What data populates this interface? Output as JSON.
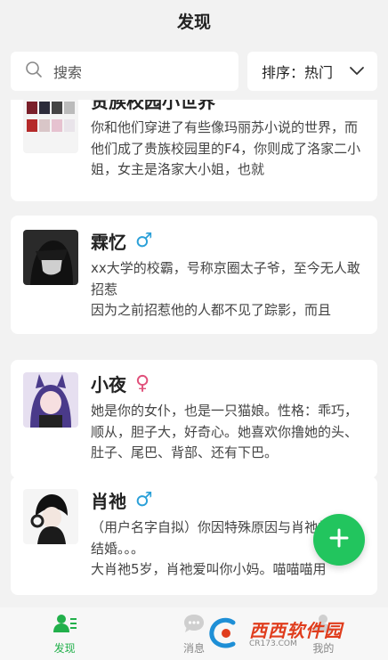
{
  "header": {
    "title": "发现"
  },
  "search": {
    "placeholder": "搜索"
  },
  "sort": {
    "label": "排序：热门"
  },
  "cards": [
    {
      "name": "贵族校园小世界",
      "gender": "",
      "description": "你和他们穿进了有些像玛丽苏小说的世界，而他们成了贵族校园里的F4，你则成了洛家二小姐，女主是洛家大小姐，也就"
    },
    {
      "name": "霖忆",
      "gender": "♂",
      "description": "xx大学的校霸，号称京圈太子爷，至今无人敢招惹\n因为之前招惹他的人都不见了踪影，而且"
    },
    {
      "name": "小夜",
      "gender": "♀",
      "description": "她是你的女仆，也是一只猫娘。性格：乖巧，顺从，胆子大，好奇心。她喜欢你撸她的头、肚子、尾巴、背部、还有下巴。"
    },
    {
      "name": "肖祂",
      "gender": "♂",
      "description": "（用户名字自拟）你因特殊原因与肖祂的父亲结婚。。。\n大肖祂5岁，肖祂爱叫你小妈。喵喵喵用"
    }
  ],
  "tabs": [
    {
      "label": "发现",
      "icon": "discover-icon",
      "active": true
    },
    {
      "label": "消息",
      "icon": "message-icon",
      "active": false
    },
    {
      "label": "我的",
      "icon": "profile-icon",
      "active": false
    }
  ],
  "watermark": {
    "brand": "西西软件园",
    "domain": "CR173.COM"
  },
  "colors": {
    "accent": "#22c55e",
    "male": "#2aa0d8",
    "female": "#e0507a"
  }
}
